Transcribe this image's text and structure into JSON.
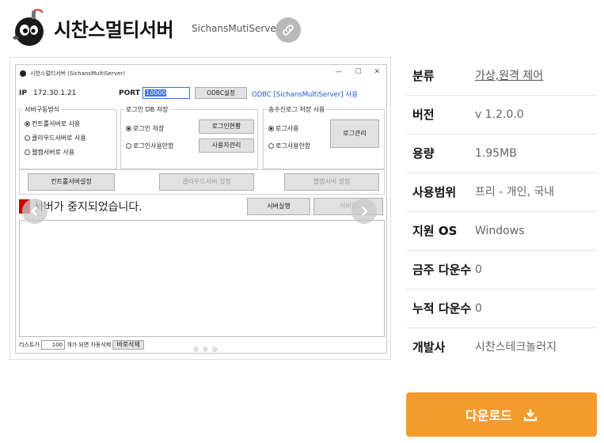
{
  "header": {
    "title": "시찬스멀티서버",
    "subtitle": "SichansMutiServer"
  },
  "window": {
    "title": "시찬스멀티서버 (SichansMultiServer)",
    "ip_label": "IP",
    "ip_value": "172.30.1.21",
    "port_label": "PORT",
    "port_value": "10000",
    "odbc_button": "ODBC설정",
    "odbc_link": "ODBC [SichansMultiServer] 사용",
    "group1": {
      "title": "서버구동방식",
      "options": [
        "컨트롤서버로 사용",
        "클라우드서버로 사용",
        "웹캠서버로 사용"
      ]
    },
    "group2": {
      "title": "로그인 DB 저장",
      "options": [
        "로그인 저장",
        "로그인사용안함"
      ],
      "btn_status": "로그인현황",
      "btn_users": "사용자관리"
    },
    "group3": {
      "title": "송수신로그 저장 사용",
      "options": [
        "로그사용",
        "로그사용안함"
      ],
      "btn_log": "로그관리"
    },
    "row3": {
      "control_setting": "컨트롤서버설정",
      "cloud_setting": "클라우드서버 설정",
      "webcam_setting": "웹캠서버 설정"
    },
    "status_text": "서버가 중지되었습니다.",
    "run_button": "서버실행",
    "stop_button": "서버중",
    "bottom": {
      "prefix": "리스트가",
      "count": "100",
      "suffix": "개가 되면 자동삭제",
      "clear_button": "바로삭제"
    }
  },
  "info": {
    "rows": [
      {
        "label": "분류",
        "value": "가상,원격 제어"
      },
      {
        "label": "버전",
        "value": "v 1.2.0.0"
      },
      {
        "label": "용량",
        "value": "1.95MB"
      },
      {
        "label": "사용범위",
        "value": "프리 - 개인, 국내"
      },
      {
        "label": "지원 OS",
        "value": "Windows"
      },
      {
        "label": "금주 다운수",
        "value": "0"
      },
      {
        "label": "누적 다운수",
        "value": "0"
      },
      {
        "label": "개발사",
        "value": "시찬스테크놀러지"
      }
    ]
  },
  "download": {
    "label": "다운로드"
  },
  "colors": {
    "download_bg": "#f49b2e",
    "link_icon_bg": "#b9b9b9"
  }
}
